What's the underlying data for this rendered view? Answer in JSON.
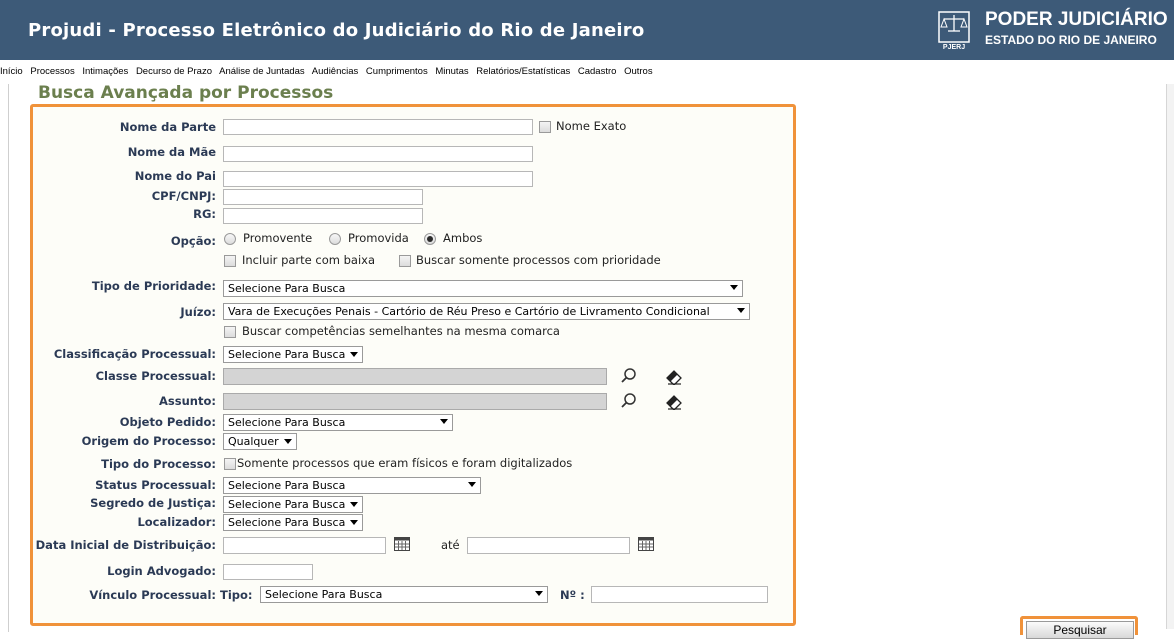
{
  "header": {
    "title": "Projudi - Processo Eletrônico do Judiciário do Rio de Janeiro",
    "brand_line1": "PODER JUDICIÁRIO",
    "brand_line2": "ESTADO DO RIO DE JANEIRO",
    "logo_text": "PJERJ",
    "colors": {
      "header_bg": "#3d5a78",
      "accent_border": "#f0923a",
      "title_green": "#6b7f4e"
    }
  },
  "menu": {
    "items": [
      "Início",
      "Processos",
      "Intimações",
      "Decurso de Prazo",
      "Análise de Juntadas",
      "Audiências",
      "Cumprimentos",
      "Minutas",
      "Relatórios/Estatísticas",
      "Cadastro",
      "Outros"
    ]
  },
  "page": {
    "title": "Busca Avançada por Processos"
  },
  "form": {
    "nome_parte": {
      "label": "Nome da Parte",
      "value": "",
      "exact_label": "Nome Exato"
    },
    "nome_mae": {
      "label": "Nome da Mãe",
      "value": ""
    },
    "nome_pai": {
      "label": "Nome do Pai",
      "value": ""
    },
    "cpf": {
      "label": "CPF/CNPJ:",
      "value": ""
    },
    "rg": {
      "label": "RG:",
      "value": ""
    },
    "opcao": {
      "label": "Opção:",
      "options": [
        "Promovente",
        "Promovida",
        "Ambos"
      ],
      "selected": "Ambos",
      "incluir_baixa": "Incluir parte com baixa",
      "somente_prioridade": "Buscar somente processos com prioridade"
    },
    "tipo_prioridade": {
      "label": "Tipo de Prioridade:",
      "value": "Selecione Para Busca"
    },
    "juizo": {
      "label": "Juízo:",
      "value": "Vara de Execuções Penais - Cartório de Réu Preso e Cartório de Livramento Condicional",
      "semelhantes": "Buscar competências semelhantes na mesma comarca"
    },
    "classificacao": {
      "label": "Classificação Processual:",
      "value": "Selecione Para Busca"
    },
    "classe": {
      "label": "Classe Processual:",
      "value": ""
    },
    "assunto": {
      "label": "Assunto:",
      "value": ""
    },
    "objeto": {
      "label": "Objeto Pedido:",
      "value": "Selecione Para Busca"
    },
    "origem": {
      "label": "Origem do Processo:",
      "value": "Qualquer"
    },
    "tipo_processo": {
      "label": "Tipo do Processo:",
      "check_label": "Somente processos que eram físicos e foram digitalizados"
    },
    "status": {
      "label": "Status Processual:",
      "value": "Selecione Para Busca"
    },
    "segredo": {
      "label": "Segredo de Justiça:",
      "value": "Selecione Para Busca"
    },
    "localizador": {
      "label": "Localizador:",
      "value": "Selecione Para Busca"
    },
    "data_inicial": {
      "label": "Data Inicial de Distribuição:",
      "from": "",
      "ate_label": "até",
      "to": ""
    },
    "login_adv": {
      "label": "Login Advogado:",
      "value": ""
    },
    "vinculo": {
      "label": "Vínculo Processual:",
      "tipo_label": "Tipo:",
      "tipo_value": "Selecione Para Busca",
      "numero_label": "Nº :",
      "numero_value": ""
    }
  },
  "actions": {
    "search_label": "Pesquisar"
  }
}
